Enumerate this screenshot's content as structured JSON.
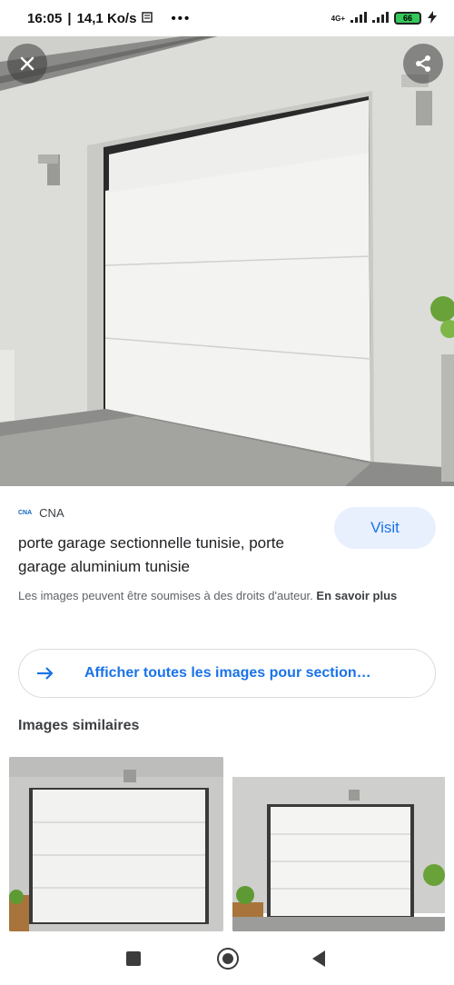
{
  "status_bar": {
    "time": "16:05",
    "speed": "14,1 Ko/s",
    "more": "•••",
    "network": "4G+",
    "battery": "66"
  },
  "hero": {
    "close_icon": "close-icon",
    "share_icon": "share-icon"
  },
  "result": {
    "source_logo": "CNA",
    "source_name": "CNA",
    "visit_label": "Visit",
    "title": "porte garage sectionnelle tunisie, porte garage aluminium tunisie",
    "copyright_text": "Les images peuvent être soumises à des droits d'auteur.",
    "learn_more": "En savoir plus"
  },
  "show_all": {
    "label": "Afficher toutes les images pour section…",
    "icon": "arrow-right-icon"
  },
  "similar": {
    "heading": "Images similaires"
  },
  "nav": {
    "recents_icon": "square-icon",
    "home_icon": "circle-icon",
    "back_icon": "triangle-back-icon"
  },
  "colors": {
    "accent": "#1a73e8",
    "visit_bg": "#e8f0fe"
  }
}
